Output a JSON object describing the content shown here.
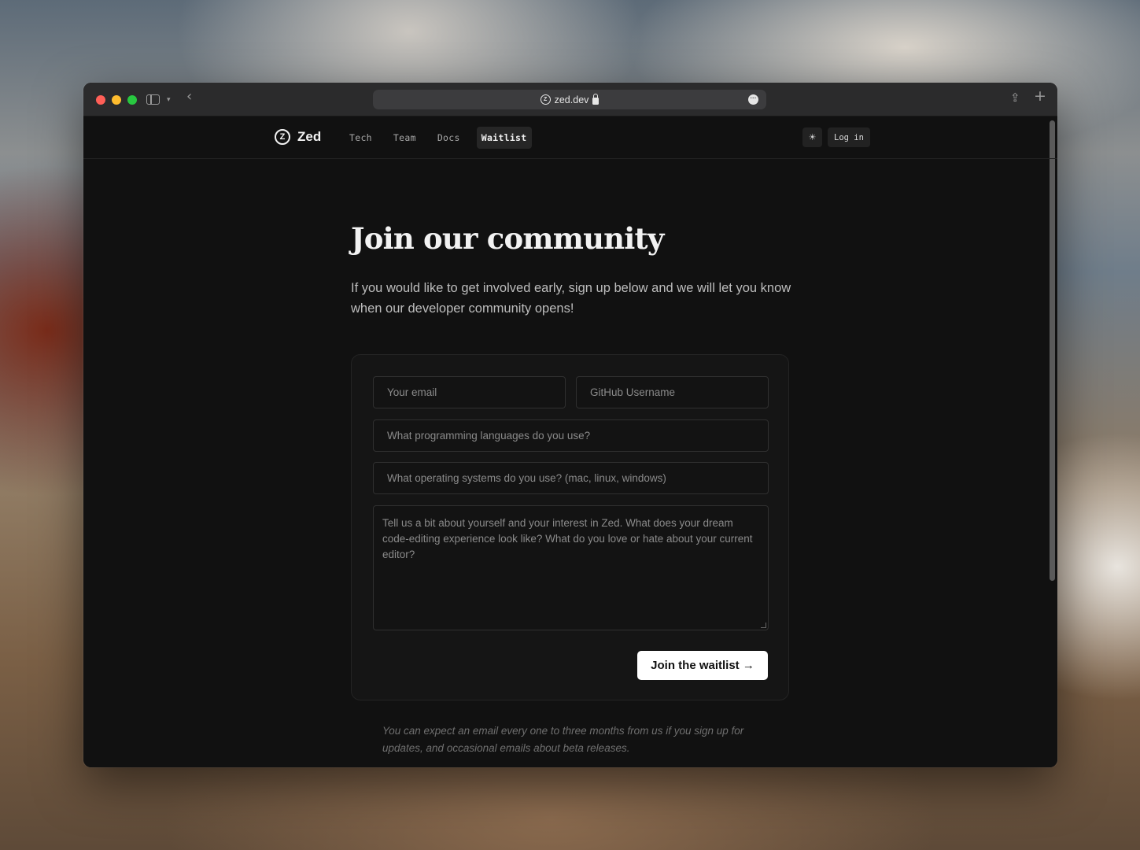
{
  "browser": {
    "url": "zed.dev",
    "icons": [
      "sidebar-icon",
      "chevron-down-icon",
      "back-icon",
      "lock-icon",
      "more-icon",
      "share-icon",
      "plus-icon"
    ]
  },
  "nav": {
    "logo_text": "Zed",
    "links": [
      {
        "label": "Tech"
      },
      {
        "label": "Team"
      },
      {
        "label": "Docs"
      },
      {
        "label": "Waitlist",
        "active": true
      }
    ],
    "theme_icon": "☀",
    "login_label": "Log in"
  },
  "page": {
    "title": "Join our community",
    "subtitle": "If you would like to get involved early, sign up below and we will let you know when our developer community opens!"
  },
  "form": {
    "email_placeholder": "Your email",
    "github_placeholder": "GitHub Username",
    "languages_placeholder": "What programming languages do you use?",
    "os_placeholder": "What operating systems do you use? (mac, linux, windows)",
    "about_placeholder": "Tell us a bit about yourself and your interest in Zed. What does your dream code-editing experience look like? What do you love or hate about your current editor?",
    "submit_label": "Join the waitlist →"
  },
  "footnote": "You can expect an email every one to three months from us if you sign up for updates, and occasional emails about beta releases.",
  "colors": {
    "background": "#111111",
    "card": "#151515",
    "button": "#ffffff"
  }
}
